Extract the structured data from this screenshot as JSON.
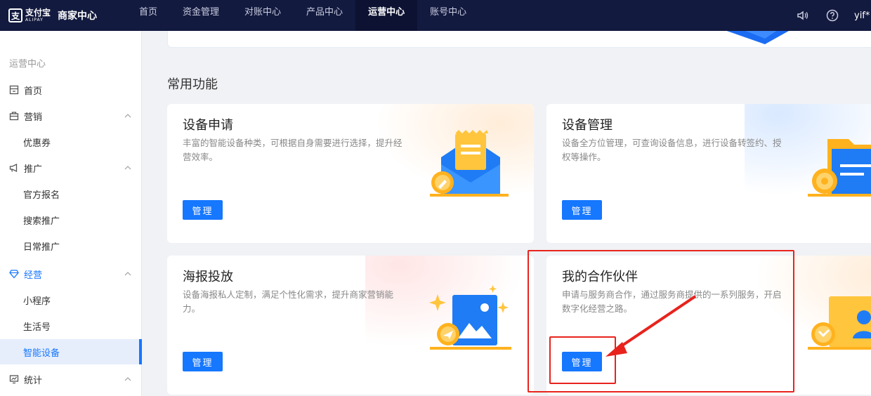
{
  "app": {
    "logo_mark": "支",
    "logo_name": "支付宝",
    "logo_sub": "ALIPAY",
    "title": "商家中心"
  },
  "nav": {
    "items": [
      {
        "label": "首页"
      },
      {
        "label": "资金管理"
      },
      {
        "label": "对账中心"
      },
      {
        "label": "产品中心"
      },
      {
        "label": "运营中心",
        "active": true
      },
      {
        "label": "账号中心"
      }
    ],
    "user": "yif*"
  },
  "sidebar": {
    "section": "运营中心",
    "items": [
      {
        "label": "首页",
        "icon": "home-icon"
      },
      {
        "label": "营销",
        "icon": "shop-icon"
      },
      {
        "label": "优惠券"
      },
      {
        "label": "推广",
        "icon": "megaphone-icon"
      },
      {
        "label": "官方报名"
      },
      {
        "label": "搜索推广"
      },
      {
        "label": "日常推广"
      },
      {
        "label": "经营",
        "icon": "gem-icon"
      },
      {
        "label": "小程序"
      },
      {
        "label": "生活号"
      },
      {
        "label": "智能设备",
        "active": true
      },
      {
        "label": "统计",
        "icon": "chart-icon"
      }
    ]
  },
  "main": {
    "section_title": "常用功能",
    "cards": [
      {
        "title": "设备申请",
        "desc": "丰富的智能设备种类，可根据自身需要进行选择，提升经营效率。",
        "button": "管理"
      },
      {
        "title": "设备管理",
        "desc": "设备全方位管理，可查询设备信息，进行设备转签约、授权等操作。",
        "button": "管理"
      },
      {
        "title": "海报投放",
        "desc": "设备海报私人定制，满足个性化需求，提升商家营销能力。",
        "button": "管理"
      },
      {
        "title": "我的合作伙伴",
        "desc": "申请与服务商合作，通过服务商提供的一系列服务，开启数字化经营之路。",
        "button": "管理"
      }
    ]
  },
  "colors": {
    "topbar": "#131a3f",
    "accent": "#1677ff",
    "annotation": "#e8231d"
  }
}
